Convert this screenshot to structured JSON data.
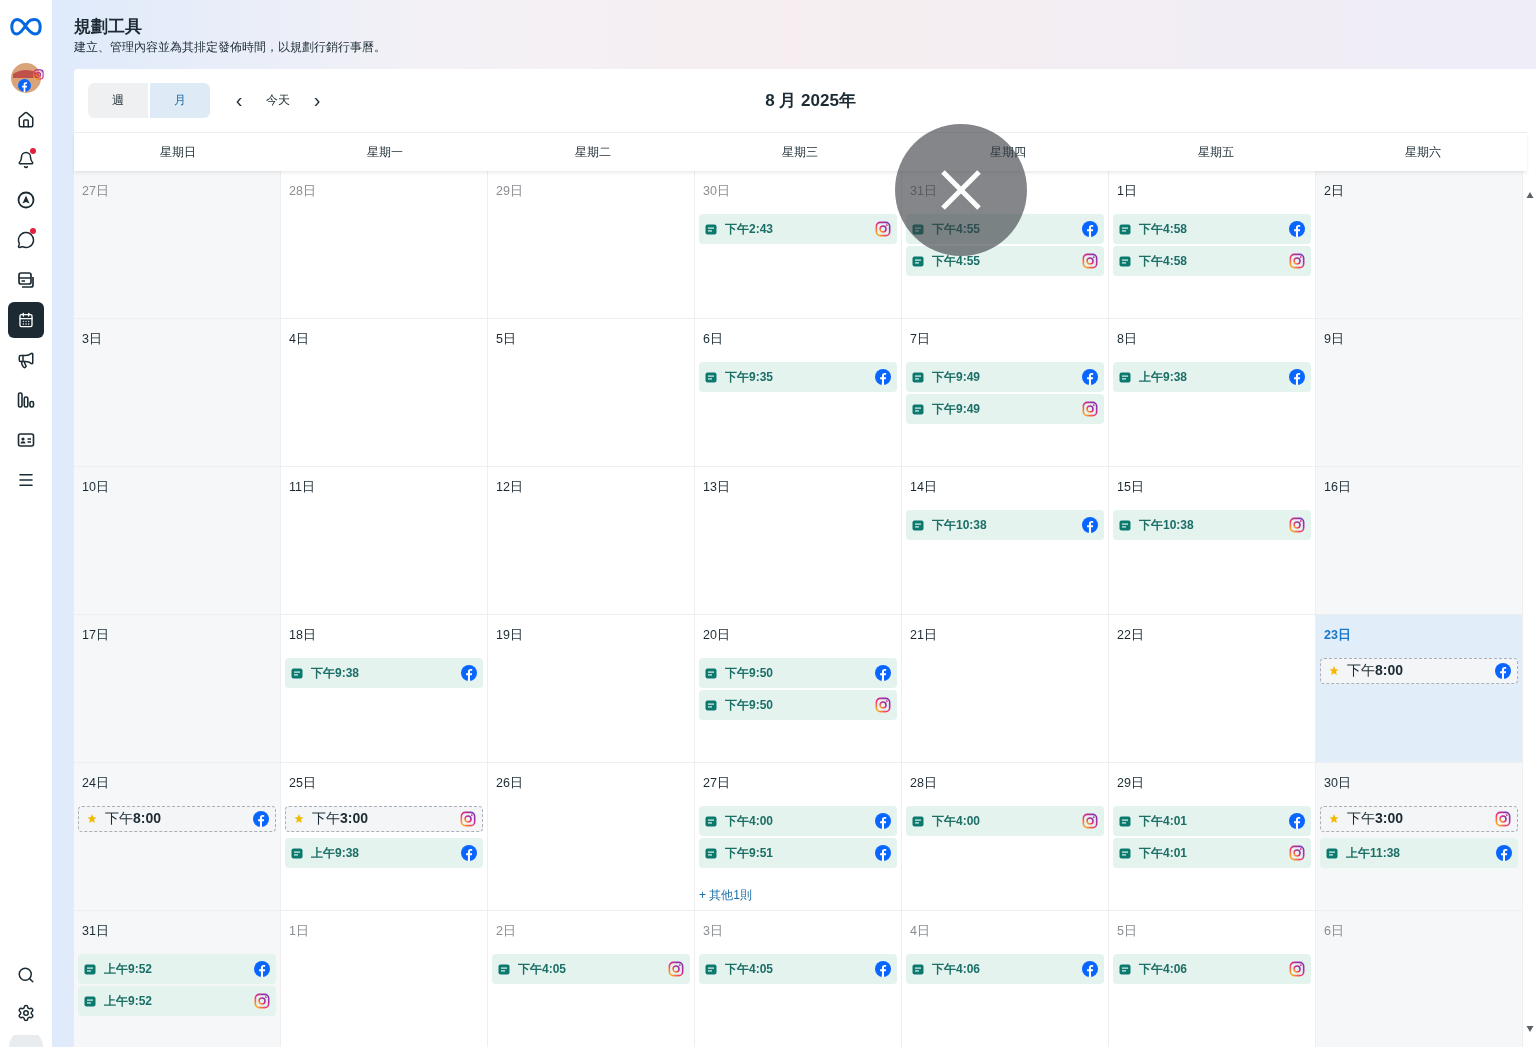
{
  "sidebar": {
    "items": [
      {
        "selected": false,
        "badge": false
      },
      {
        "selected": false,
        "badge": true
      },
      {
        "selected": false,
        "badge": false
      },
      {
        "selected": false,
        "badge": true
      },
      {
        "selected": false,
        "badge": false
      },
      {
        "selected": true,
        "badge": false
      },
      {
        "selected": false,
        "badge": false
      },
      {
        "selected": false,
        "badge": false
      },
      {
        "selected": false,
        "badge": false
      },
      {
        "selected": false,
        "badge": false
      }
    ]
  },
  "header": {
    "title": "規劃工具",
    "subtitle": "建立、管理內容並為其排定發佈時間，以規劃行銷行事曆。"
  },
  "toolbar": {
    "views": [
      {
        "label": "週",
        "selected": false
      },
      {
        "label": "月",
        "selected": true
      }
    ],
    "prev": "‹",
    "today": "今天",
    "next": "›",
    "month_title": "8 月 2025年"
  },
  "weekdays": [
    "星期日",
    "星期一",
    "星期二",
    "星期三",
    "星期四",
    "星期五",
    "星期六"
  ],
  "weeks": [
    [
      {
        "label": "27日",
        "muted": true,
        "today": false
      },
      {
        "label": "28日",
        "muted": true,
        "today": false
      },
      {
        "label": "29日",
        "muted": true,
        "today": false
      },
      {
        "label": "30日",
        "muted": true,
        "today": false,
        "events": [
          {
            "kind": "post",
            "time": "下午2:43",
            "instagram": true
          }
        ]
      },
      {
        "label": "31日",
        "muted": true,
        "today": false,
        "events": [
          {
            "kind": "post",
            "time": "下午4:55",
            "instagram": false
          },
          {
            "kind": "post",
            "time": "下午4:55",
            "instagram": true
          }
        ]
      },
      {
        "label": "1日",
        "muted": false,
        "today": false,
        "events": [
          {
            "kind": "post",
            "time": "下午4:58",
            "instagram": false
          },
          {
            "kind": "post",
            "time": "下午4:58",
            "instagram": true
          }
        ]
      },
      {
        "label": "2日",
        "muted": false,
        "today": false
      }
    ],
    [
      {
        "label": "3日",
        "muted": false,
        "today": false
      },
      {
        "label": "4日",
        "muted": false,
        "today": false
      },
      {
        "label": "5日",
        "muted": false,
        "today": false
      },
      {
        "label": "6日",
        "muted": false,
        "today": false,
        "events": [
          {
            "kind": "post",
            "time": "下午9:35",
            "instagram": false
          }
        ]
      },
      {
        "label": "7日",
        "muted": false,
        "today": false,
        "events": [
          {
            "kind": "post",
            "time": "下午9:49",
            "instagram": false
          },
          {
            "kind": "post",
            "time": "下午9:49",
            "instagram": true
          }
        ]
      },
      {
        "label": "8日",
        "muted": false,
        "today": false,
        "events": [
          {
            "kind": "post",
            "time": "上午9:38",
            "instagram": false
          }
        ]
      },
      {
        "label": "9日",
        "muted": false,
        "today": false
      }
    ],
    [
      {
        "label": "10日",
        "muted": false,
        "today": false
      },
      {
        "label": "11日",
        "muted": false,
        "today": false
      },
      {
        "label": "12日",
        "muted": false,
        "today": false
      },
      {
        "label": "13日",
        "muted": false,
        "today": false
      },
      {
        "label": "14日",
        "muted": false,
        "today": false,
        "events": [
          {
            "kind": "post",
            "time": "下午10:38",
            "instagram": false
          }
        ]
      },
      {
        "label": "15日",
        "muted": false,
        "today": false,
        "events": [
          {
            "kind": "post",
            "time": "下午10:38",
            "instagram": true
          }
        ]
      },
      {
        "label": "16日",
        "muted": false,
        "today": false
      }
    ],
    [
      {
        "label": "17日",
        "muted": false,
        "today": false
      },
      {
        "label": "18日",
        "muted": false,
        "today": false,
        "events": [
          {
            "kind": "post",
            "time": "下午9:38",
            "instagram": false
          }
        ]
      },
      {
        "label": "19日",
        "muted": false,
        "today": false
      },
      {
        "label": "20日",
        "muted": false,
        "today": false,
        "events": [
          {
            "kind": "post",
            "time": "下午9:50",
            "instagram": false
          },
          {
            "kind": "post",
            "time": "下午9:50",
            "instagram": true
          }
        ]
      },
      {
        "label": "21日",
        "muted": false,
        "today": false
      },
      {
        "label": "22日",
        "muted": false,
        "today": false
      },
      {
        "label": "23日",
        "muted": false,
        "today": true,
        "events": [
          {
            "kind": "draft",
            "time": "下午**8:00**",
            "instagram": false
          }
        ]
      }
    ],
    [
      {
        "label": "24日",
        "muted": false,
        "today": false,
        "events": [
          {
            "kind": "draft",
            "time": "下午**8:00**",
            "instagram": false
          }
        ]
      },
      {
        "label": "25日",
        "muted": false,
        "today": false,
        "events": [
          {
            "kind": "draft",
            "time": "下午**3:00**",
            "instagram": true
          },
          {
            "kind": "post",
            "time": "上午9:38",
            "instagram": false
          }
        ]
      },
      {
        "label": "26日",
        "muted": false,
        "today": false
      },
      {
        "label": "27日",
        "muted": false,
        "today": false,
        "events": [
          {
            "kind": "post",
            "time": "下午4:00",
            "instagram": false
          },
          {
            "kind": "post",
            "time": "下午9:51",
            "instagram": false
          }
        ],
        "more": "+ 其他1則"
      },
      {
        "label": "28日",
        "muted": false,
        "today": false,
        "events": [
          {
            "kind": "post",
            "time": "下午4:00",
            "instagram": true
          }
        ]
      },
      {
        "label": "29日",
        "muted": false,
        "today": false,
        "events": [
          {
            "kind": "post",
            "time": "下午4:01",
            "instagram": false
          },
          {
            "kind": "post",
            "time": "下午4:01",
            "instagram": true
          }
        ]
      },
      {
        "label": "30日",
        "muted": false,
        "today": false,
        "events": [
          {
            "kind": "draft",
            "time": "下午**3:00**",
            "instagram": true
          },
          {
            "kind": "post",
            "time": "上午11:38",
            "instagram": false
          }
        ]
      }
    ],
    [
      {
        "label": "31日",
        "muted": false,
        "today": false,
        "events": [
          {
            "kind": "post",
            "time": "上午9:52",
            "instagram": false
          },
          {
            "kind": "post",
            "time": "上午9:52",
            "instagram": true
          }
        ]
      },
      {
        "label": "1日",
        "muted": true,
        "today": false
      },
      {
        "label": "2日",
        "muted": true,
        "today": false,
        "events": [
          {
            "kind": "post",
            "time": "下午4:05",
            "instagram": true
          }
        ]
      },
      {
        "label": "3日",
        "muted": true,
        "today": false,
        "events": [
          {
            "kind": "post",
            "time": "下午4:05",
            "instagram": false
          }
        ]
      },
      {
        "label": "4日",
        "muted": true,
        "today": false,
        "events": [
          {
            "kind": "post",
            "time": "下午4:06",
            "instagram": false
          }
        ]
      },
      {
        "label": "5日",
        "muted": true,
        "today": false,
        "events": [
          {
            "kind": "post",
            "time": "下午4:06",
            "instagram": true
          }
        ]
      },
      {
        "label": "6日",
        "muted": true,
        "today": false
      }
    ]
  ]
}
